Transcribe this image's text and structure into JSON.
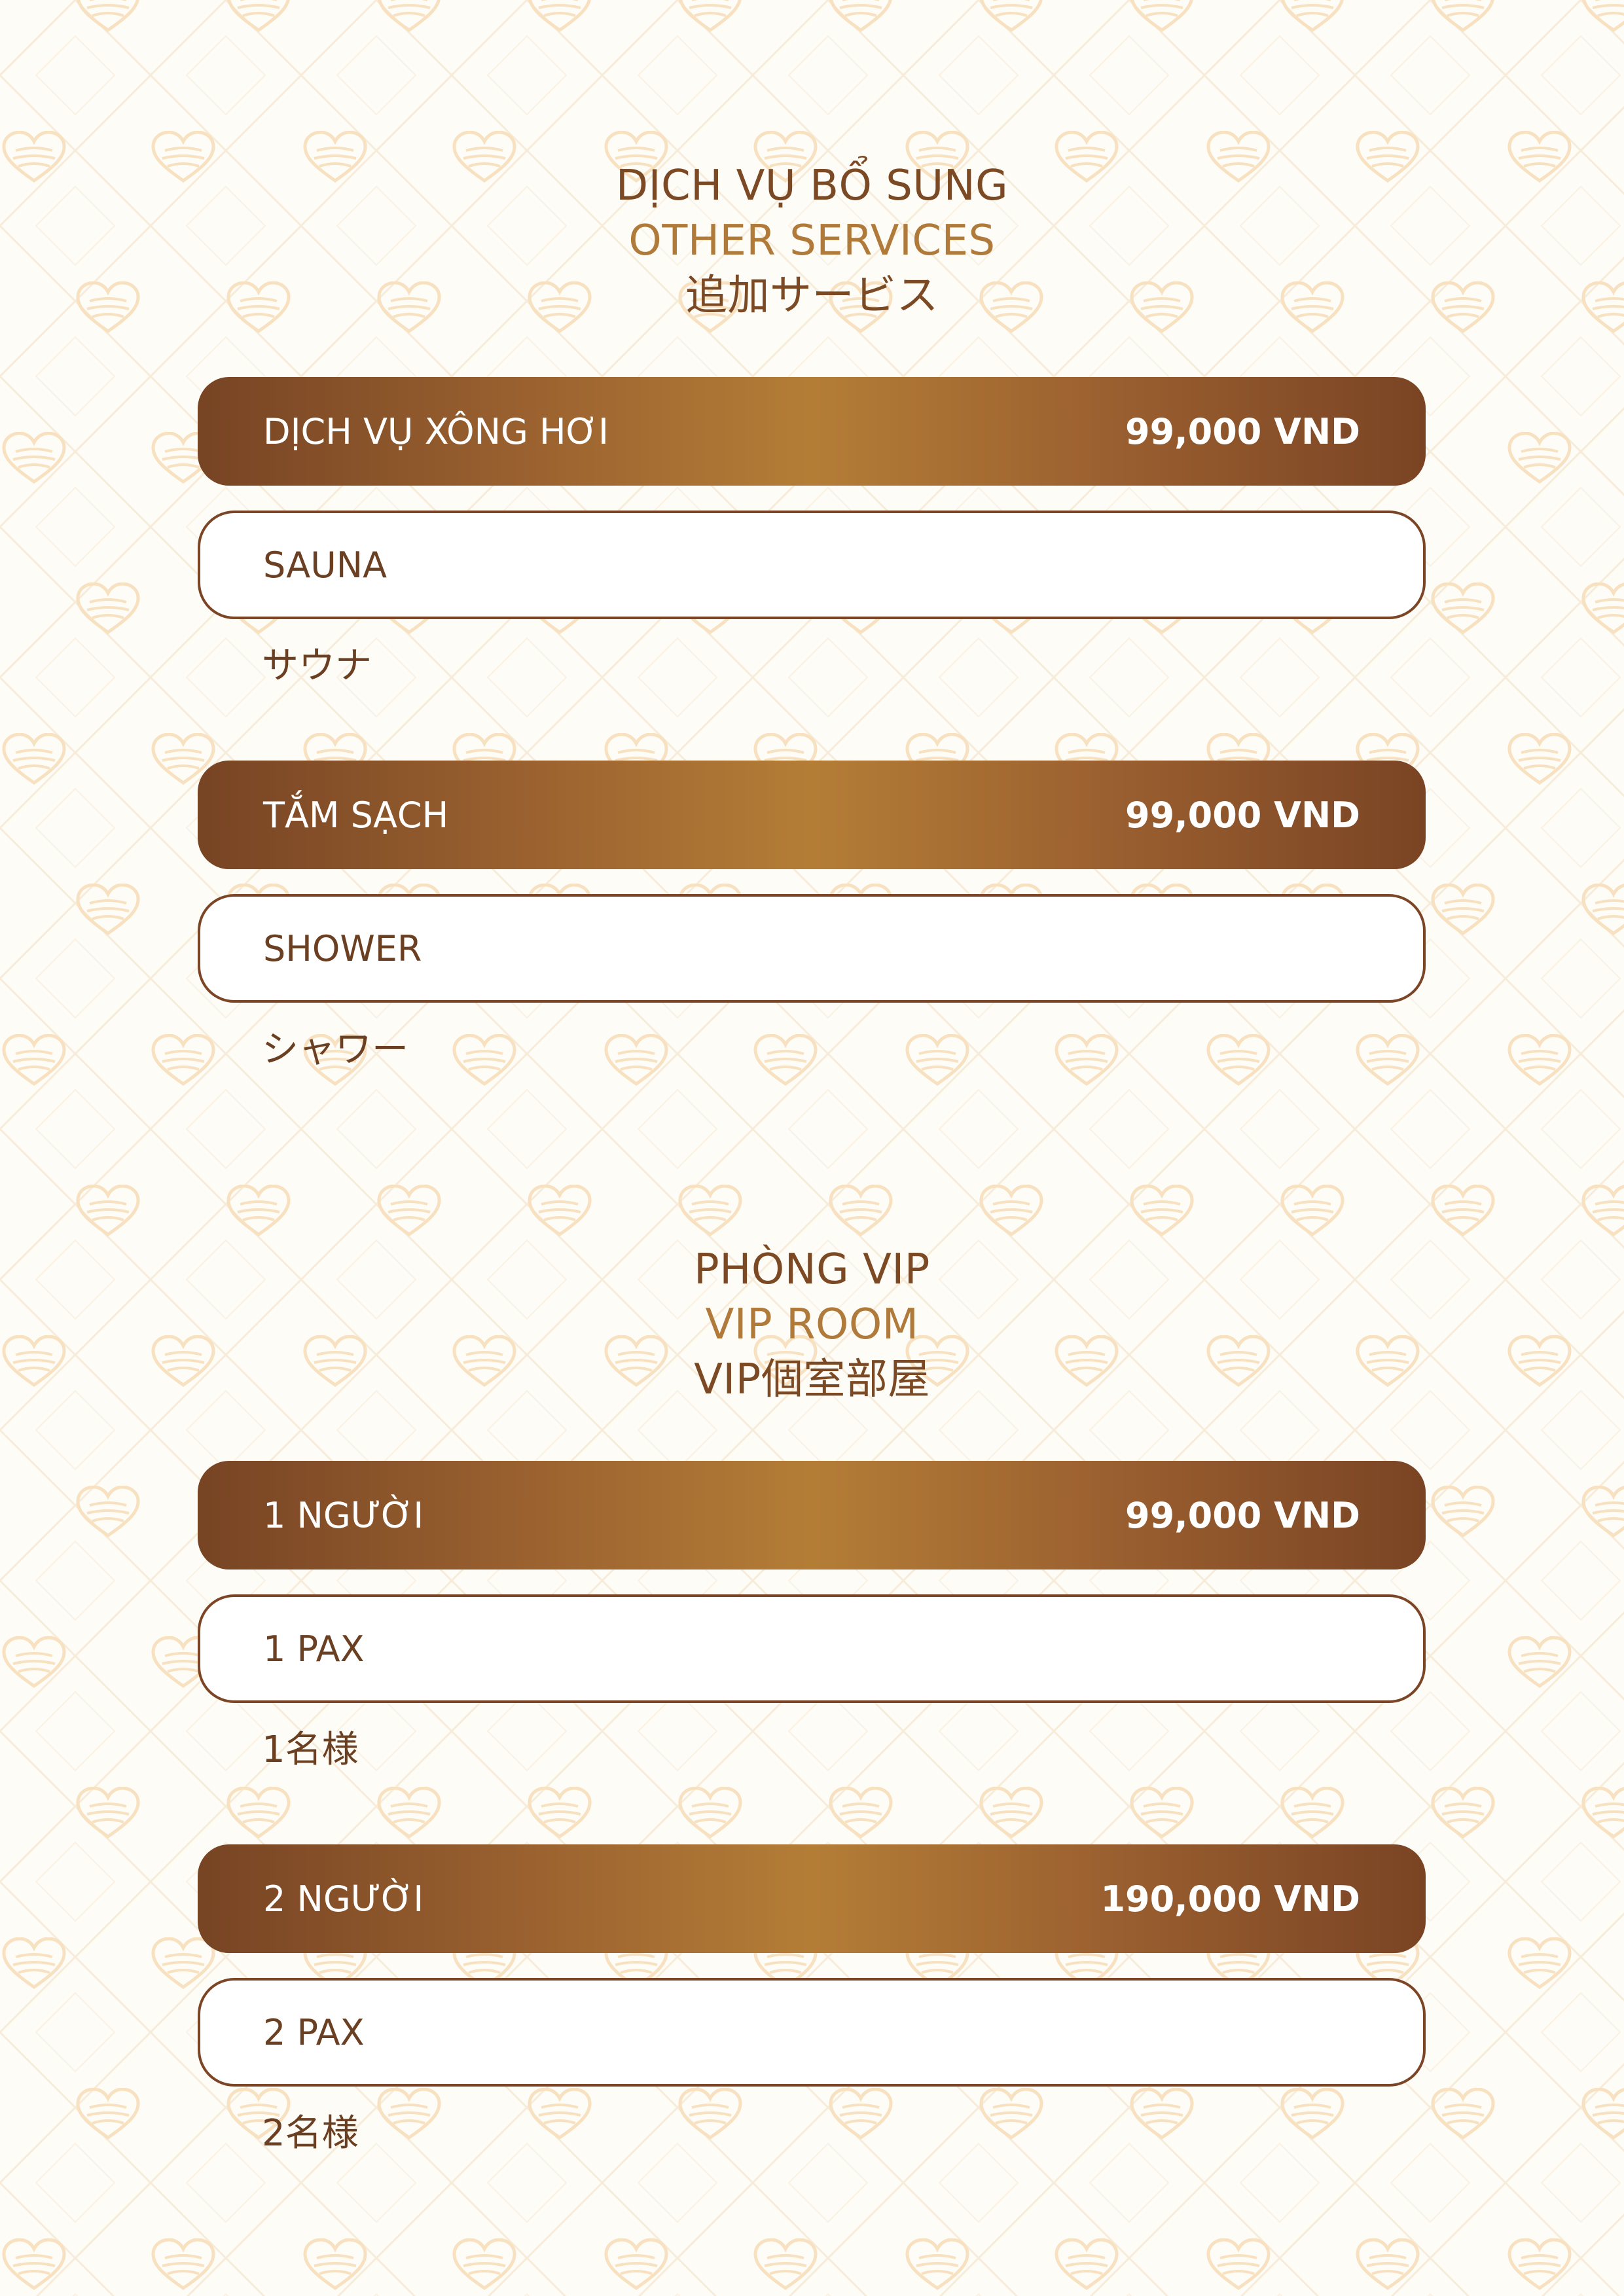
{
  "colors": {
    "accent_dark": "#774424",
    "accent_light": "#b47d36",
    "text_brown": "#6b3f22",
    "pattern": "#f7e2c2",
    "background": "#fefcf7"
  },
  "pattern_icon": "heart-icon",
  "sections": [
    {
      "title_vi": "DỊCH VỤ BỔ SUNG",
      "title_en": "OTHER SERVICES",
      "title_jp": "追加サービス",
      "items": [
        {
          "name_vi": "DỊCH VỤ XÔNG HƠI",
          "price": "99,000 VND",
          "name_en": "SAUNA",
          "name_jp": "サウナ"
        },
        {
          "name_vi": "TẮM SẠCH",
          "price": "99,000 VND",
          "name_en": "SHOWER",
          "name_jp": "シャワー"
        }
      ]
    },
    {
      "title_vi": "PHÒNG VIP",
      "title_en": "VIP ROOM",
      "title_jp": "VIP個室部屋",
      "items": [
        {
          "name_vi": "1 NGƯỜI",
          "price": "99,000 VND",
          "name_en": "1 PAX",
          "name_jp": "1名様"
        },
        {
          "name_vi": "2 NGƯỜI",
          "price": "190,000 VND",
          "name_en": "2 PAX",
          "name_jp": "2名様"
        }
      ]
    }
  ]
}
